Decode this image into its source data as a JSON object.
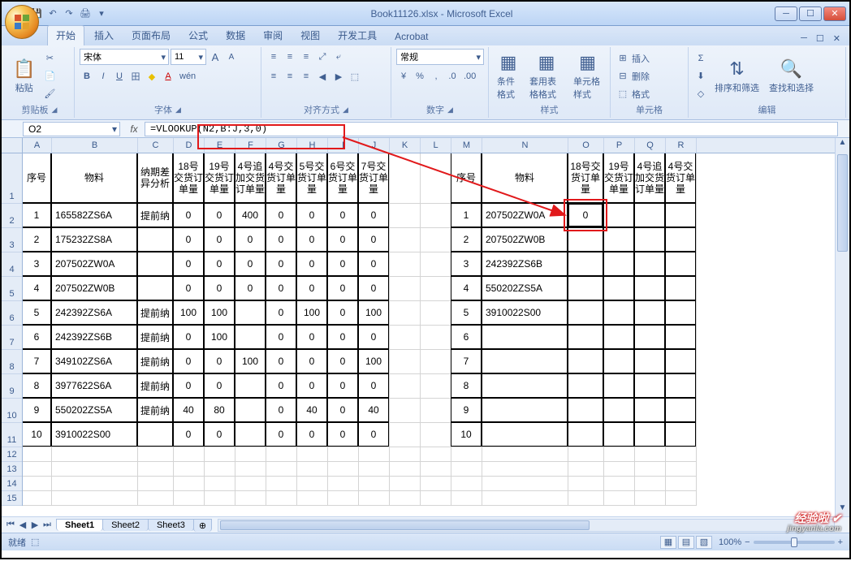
{
  "window": {
    "title": "Book11126.xlsx - Microsoft Excel"
  },
  "qat": {
    "save": "💾",
    "undo": "↶",
    "redo": "↷",
    "print": "🖨",
    "dd": "▾"
  },
  "tabs": {
    "items": [
      "开始",
      "插入",
      "页面布局",
      "公式",
      "数据",
      "审阅",
      "视图",
      "开发工具",
      "Acrobat"
    ],
    "active": 0
  },
  "ribbon": {
    "clipboard": {
      "label": "剪贴板",
      "paste": "粘贴",
      "cut": "✂",
      "copy": "📄",
      "fmt": "🖌"
    },
    "font": {
      "label": "字体",
      "name": "宋体",
      "size": "11",
      "grow": "A",
      "shrink": "A",
      "b": "B",
      "i": "I",
      "u": "U",
      "border": "田",
      "fill": "◆",
      "color": "A",
      "phonetic": "wén"
    },
    "align": {
      "label": "对齐方式",
      "tl": "≡",
      "tc": "≡",
      "tr": "≡",
      "ml": "≡",
      "mc": "≡",
      "mr": "≡",
      "indL": "◀",
      "indR": "▶",
      "wrap": "⤶",
      "merge": "⬚"
    },
    "number": {
      "label": "数字",
      "format": "常规",
      "cur": "¥",
      "pct": "%",
      "comma": ",",
      "inc": ".0",
      "dec": ".00"
    },
    "styles": {
      "label": "样式",
      "cond": "条件格式",
      "table": "套用表格格式",
      "cell": "单元格样式"
    },
    "cells": {
      "label": "单元格",
      "insert": "插入",
      "delete": "删除",
      "format": "格式"
    },
    "edit": {
      "label": "编辑",
      "sum": "Σ",
      "fill": "⬇",
      "clear": "◇",
      "sort": "排序和筛选",
      "find": "查找和选择"
    }
  },
  "formula": {
    "cellref": "O2",
    "text": "=VLOOKUP(N2,B:J,3,0)",
    "fx": "fx"
  },
  "cols": {
    "letters": [
      "A",
      "B",
      "C",
      "D",
      "E",
      "F",
      "G",
      "H",
      "I",
      "J",
      "K",
      "L",
      "M",
      "N",
      "O",
      "P",
      "Q",
      "R"
    ],
    "widths": [
      36,
      106,
      44,
      38,
      38,
      38,
      38,
      38,
      38,
      38,
      38,
      38,
      38,
      106,
      44,
      38,
      38,
      38
    ]
  },
  "rows": {
    "heights": [
      62,
      30,
      30,
      30,
      30,
      30,
      30,
      30,
      30,
      30,
      30,
      18,
      18,
      18,
      18
    ],
    "labels": [
      "1",
      "2",
      "3",
      "4",
      "5",
      "6",
      "7",
      "8",
      "9",
      "10",
      "11",
      "12",
      "13",
      "14",
      "15"
    ]
  },
  "headers1": [
    "序号",
    "物料",
    "纳期差异分析",
    "18号交货订单量",
    "19号交货订单量",
    "4号追加交货订单量",
    "4号交货订单量",
    "5号交货订单量",
    "6号交货订单量",
    "7号交货订单量"
  ],
  "headers2": [
    "序号",
    "物料",
    "18号交货订单量",
    "19号交货订单量",
    "4号追加交货订单量",
    "4号交货订单量"
  ],
  "data1": [
    [
      "1",
      "165582ZS6A",
      "提前纳",
      "0",
      "0",
      "400",
      "0",
      "0",
      "0",
      "0"
    ],
    [
      "2",
      "175232ZS8A",
      "",
      "0",
      "0",
      "0",
      "0",
      "0",
      "0",
      "0"
    ],
    [
      "3",
      "207502ZW0A",
      "",
      "0",
      "0",
      "0",
      "0",
      "0",
      "0",
      "0"
    ],
    [
      "4",
      "207502ZW0B",
      "",
      "0",
      "0",
      "0",
      "0",
      "0",
      "0",
      "0"
    ],
    [
      "5",
      "242392ZS6A",
      "提前纳",
      "100",
      "100",
      "",
      "0",
      "100",
      "0",
      "100"
    ],
    [
      "6",
      "242392ZS6B",
      "提前纳",
      "0",
      "100",
      "",
      "0",
      "0",
      "0",
      "0"
    ],
    [
      "7",
      "349102ZS6A",
      "提前纳",
      "0",
      "0",
      "100",
      "0",
      "0",
      "0",
      "100"
    ],
    [
      "8",
      "3977622S6A",
      "提前纳",
      "0",
      "0",
      "",
      "0",
      "0",
      "0",
      "0"
    ],
    [
      "9",
      "550202ZS5A",
      "提前纳",
      "40",
      "80",
      "",
      "0",
      "40",
      "0",
      "40"
    ],
    [
      "10",
      "3910022S00",
      "",
      "0",
      "0",
      "",
      "0",
      "0",
      "0",
      "0"
    ]
  ],
  "data2": [
    [
      "1",
      "207502ZW0A",
      "0",
      "",
      "",
      ""
    ],
    [
      "2",
      "207502ZW0B",
      "",
      "",
      "",
      ""
    ],
    [
      "3",
      "242392ZS6B",
      "",
      "",
      "",
      ""
    ],
    [
      "4",
      "550202ZS5A",
      "",
      "",
      "",
      ""
    ],
    [
      "5",
      "3910022S00",
      "",
      "",
      "",
      ""
    ],
    [
      "6",
      "",
      "",
      "",
      "",
      ""
    ],
    [
      "7",
      "",
      "",
      "",
      "",
      ""
    ],
    [
      "8",
      "",
      "",
      "",
      "",
      ""
    ],
    [
      "9",
      "",
      "",
      "",
      "",
      ""
    ],
    [
      "10",
      "",
      "",
      "",
      "",
      ""
    ]
  ],
  "sheets": {
    "items": [
      "Sheet1",
      "Sheet2",
      "Sheet3"
    ],
    "active": 0
  },
  "status": {
    "ready": "就绪",
    "zoom": "100%",
    "macro": "⬚"
  },
  "watermark": {
    "main": "经验啦 ✔",
    "sub": "jingyanla.com"
  }
}
